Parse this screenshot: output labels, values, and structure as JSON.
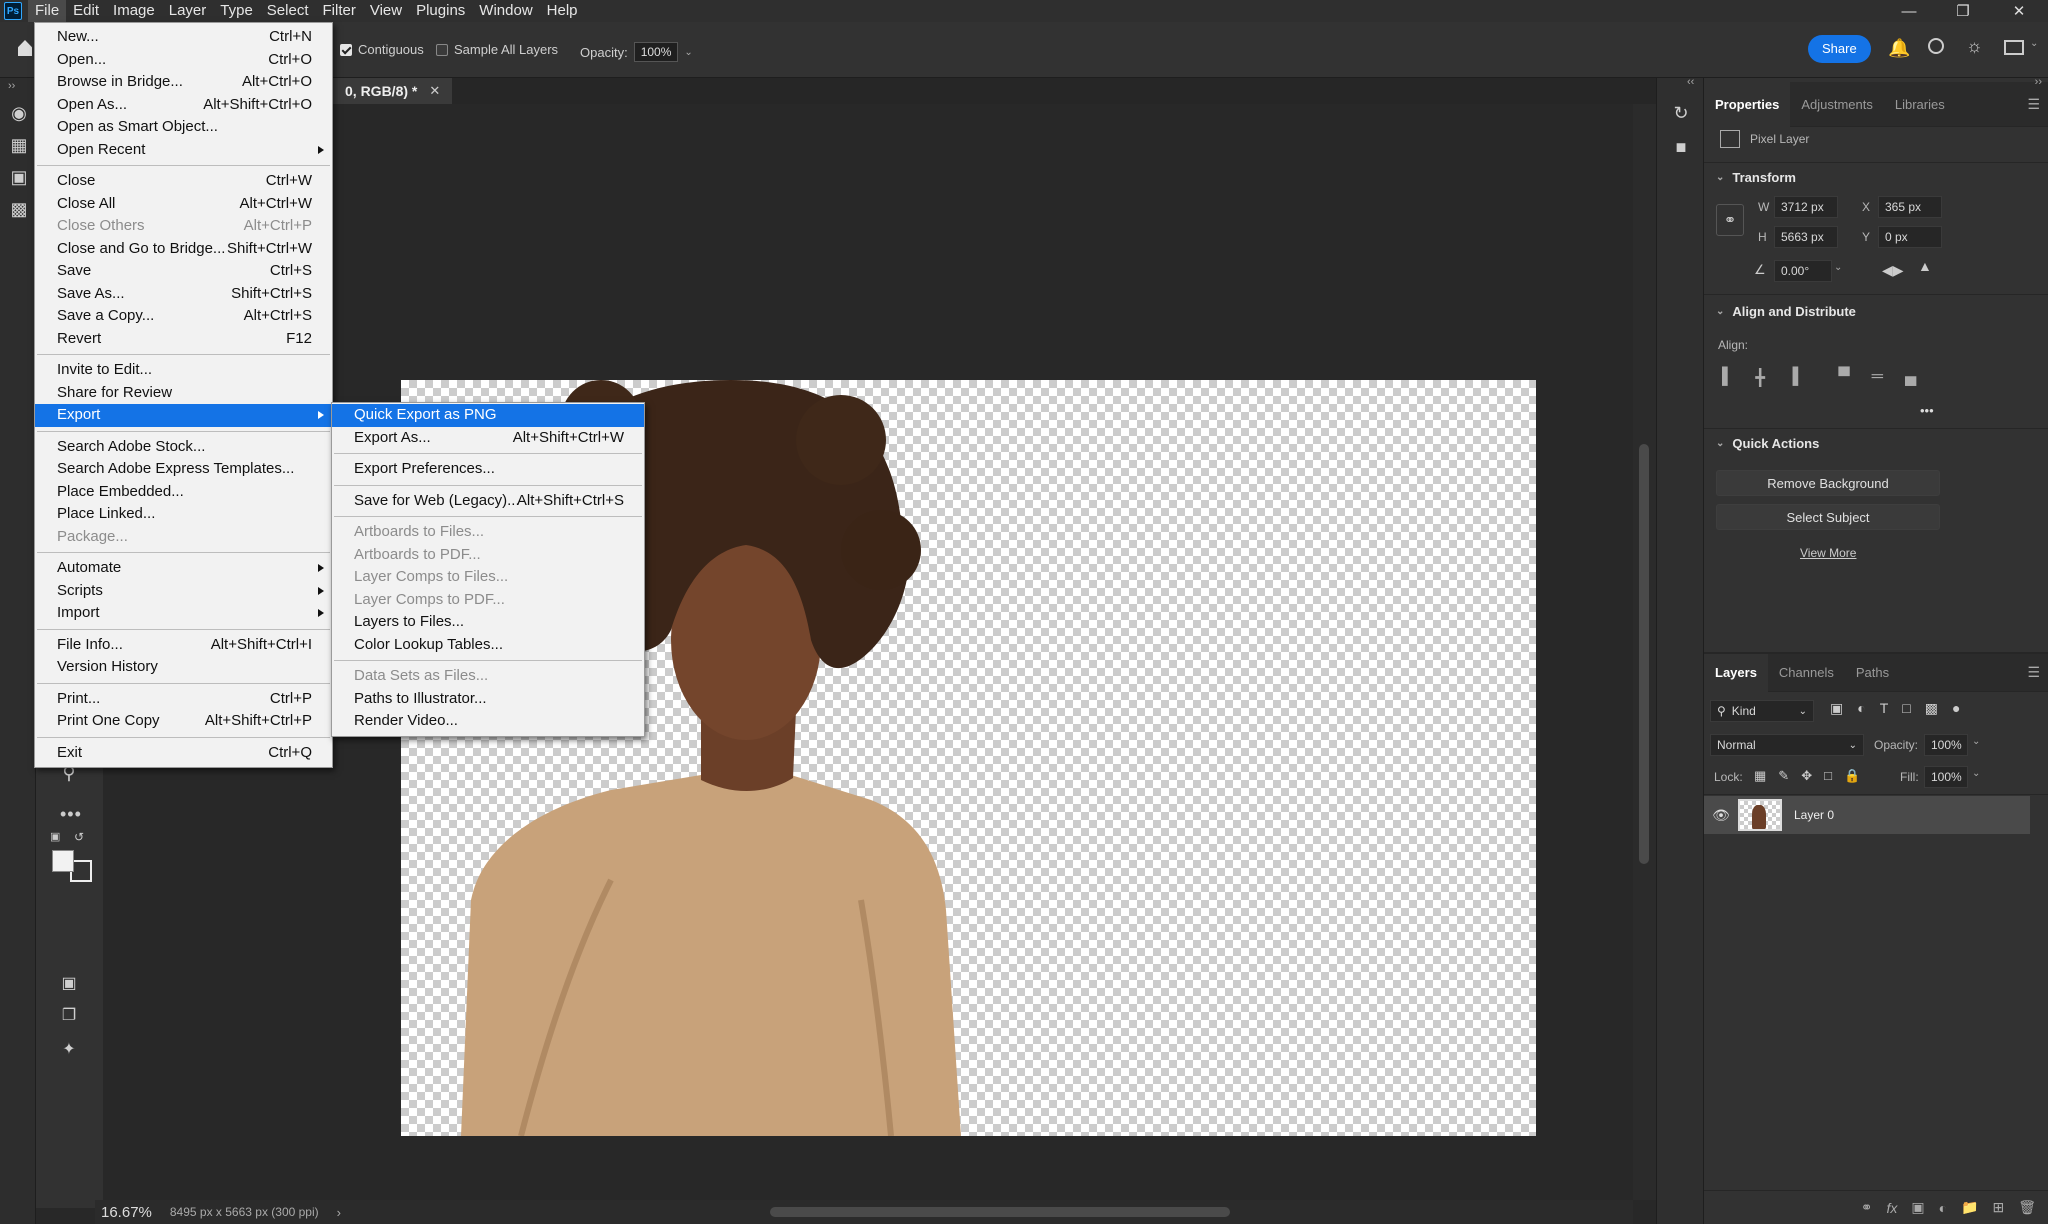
{
  "menubar": {
    "logo": "Ps",
    "items": [
      "File",
      "Edit",
      "Image",
      "Layer",
      "Type",
      "Select",
      "Filter",
      "View",
      "Plugins",
      "Window",
      "Help"
    ]
  },
  "options": {
    "contiguous_label": "Contiguous",
    "sample_all_label": "Sample All Layers",
    "opacity_label": "Opacity:",
    "opacity_value": "100%",
    "share_label": "Share"
  },
  "document": {
    "tab_title": "0, RGB/8) *",
    "zoom": "16.67%",
    "doc_info": "8495 px x 5663 px (300 ppi)"
  },
  "file_menu": {
    "items": [
      {
        "label": "New...",
        "shortcut": "Ctrl+N"
      },
      {
        "label": "Open...",
        "shortcut": "Ctrl+O"
      },
      {
        "label": "Browse in Bridge...",
        "shortcut": "Alt+Ctrl+O"
      },
      {
        "label": "Open As...",
        "shortcut": "Alt+Shift+Ctrl+O"
      },
      {
        "label": "Open as Smart Object...",
        "shortcut": ""
      },
      {
        "label": "Open Recent",
        "shortcut": "",
        "submenu": true
      },
      {
        "sep": true
      },
      {
        "label": "Close",
        "shortcut": "Ctrl+W"
      },
      {
        "label": "Close All",
        "shortcut": "Alt+Ctrl+W"
      },
      {
        "label": "Close Others",
        "shortcut": "Alt+Ctrl+P",
        "disabled": true
      },
      {
        "label": "Close and Go to Bridge...",
        "shortcut": "Shift+Ctrl+W"
      },
      {
        "label": "Save",
        "shortcut": "Ctrl+S"
      },
      {
        "label": "Save As...",
        "shortcut": "Shift+Ctrl+S"
      },
      {
        "label": "Save a Copy...",
        "shortcut": "Alt+Ctrl+S"
      },
      {
        "label": "Revert",
        "shortcut": "F12"
      },
      {
        "sep": true
      },
      {
        "label": "Invite to Edit...",
        "shortcut": ""
      },
      {
        "label": "Share for Review",
        "shortcut": ""
      },
      {
        "label": "Export",
        "shortcut": "",
        "submenu": true,
        "highlighted": true
      },
      {
        "sep": true
      },
      {
        "label": "Search Adobe Stock...",
        "shortcut": ""
      },
      {
        "label": "Search Adobe Express Templates...",
        "shortcut": ""
      },
      {
        "label": "Place Embedded...",
        "shortcut": ""
      },
      {
        "label": "Place Linked...",
        "shortcut": ""
      },
      {
        "label": "Package...",
        "shortcut": "",
        "disabled": true
      },
      {
        "sep": true
      },
      {
        "label": "Automate",
        "shortcut": "",
        "submenu": true
      },
      {
        "label": "Scripts",
        "shortcut": "",
        "submenu": true
      },
      {
        "label": "Import",
        "shortcut": "",
        "submenu": true
      },
      {
        "sep": true
      },
      {
        "label": "File Info...",
        "shortcut": "Alt+Shift+Ctrl+I"
      },
      {
        "label": "Version History",
        "shortcut": ""
      },
      {
        "sep": true
      },
      {
        "label": "Print...",
        "shortcut": "Ctrl+P"
      },
      {
        "label": "Print One Copy",
        "shortcut": "Alt+Shift+Ctrl+P"
      },
      {
        "sep": true
      },
      {
        "label": "Exit",
        "shortcut": "Ctrl+Q"
      }
    ]
  },
  "export_menu": {
    "items": [
      {
        "label": "Quick Export as PNG",
        "shortcut": "",
        "highlighted": true
      },
      {
        "label": "Export As...",
        "shortcut": "Alt+Shift+Ctrl+W"
      },
      {
        "sep": true
      },
      {
        "label": "Export Preferences...",
        "shortcut": ""
      },
      {
        "sep": true
      },
      {
        "label": "Save for Web (Legacy)...",
        "shortcut": "Alt+Shift+Ctrl+S"
      },
      {
        "sep": true
      },
      {
        "label": "Artboards to Files...",
        "shortcut": "",
        "disabled": true
      },
      {
        "label": "Artboards to PDF...",
        "shortcut": "",
        "disabled": true
      },
      {
        "label": "Layer Comps to Files...",
        "shortcut": "",
        "disabled": true
      },
      {
        "label": "Layer Comps to PDF...",
        "shortcut": "",
        "disabled": true
      },
      {
        "label": "Layers to Files...",
        "shortcut": ""
      },
      {
        "label": "Color Lookup Tables...",
        "shortcut": ""
      },
      {
        "sep": true
      },
      {
        "label": "Data Sets as Files...",
        "shortcut": "",
        "disabled": true
      },
      {
        "label": "Paths to Illustrator...",
        "shortcut": ""
      },
      {
        "label": "Render Video...",
        "shortcut": ""
      }
    ]
  },
  "properties": {
    "tabs": [
      "Properties",
      "Adjustments",
      "Libraries"
    ],
    "layer_type": "Pixel Layer",
    "transform_title": "Transform",
    "w_label": "W",
    "w_value": "3712 px",
    "h_label": "H",
    "h_value": "5663 px",
    "x_label": "X",
    "x_value": "365 px",
    "y_label": "Y",
    "y_value": "0 px",
    "angle_value": "0.00°",
    "align_title": "Align and Distribute",
    "align_label": "Align:",
    "more_label": "•••",
    "quick_actions_title": "Quick Actions",
    "remove_bg": "Remove Background",
    "select_subject": "Select Subject",
    "view_more": "View More"
  },
  "layers": {
    "tabs": [
      "Layers",
      "Channels",
      "Paths"
    ],
    "kind_label": "Kind",
    "blend_mode": "Normal",
    "opacity_label": "Opacity:",
    "opacity_value": "100%",
    "lock_label": "Lock:",
    "fill_label": "Fill:",
    "fill_value": "100%",
    "layer_name": "Layer 0"
  },
  "colors": {
    "accent": "#1473e6",
    "menu_bg": "#f2f2f2",
    "app_bg": "#282828"
  }
}
